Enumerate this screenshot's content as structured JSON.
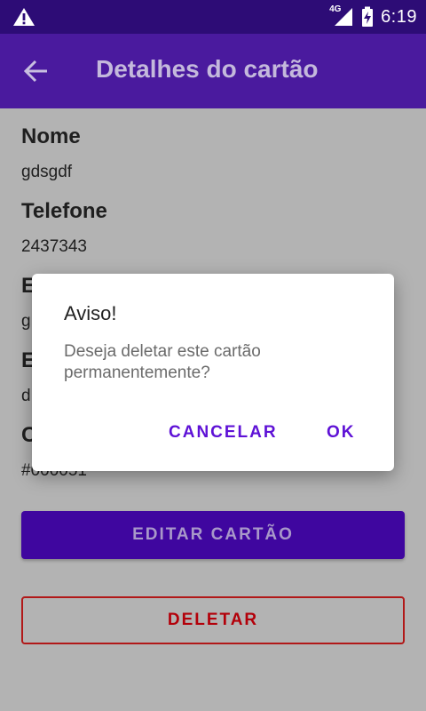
{
  "statusbar": {
    "network": "4G",
    "time": "6:19",
    "icons": [
      "warning-icon",
      "signal-icon",
      "battery-charging-icon"
    ]
  },
  "appbar": {
    "title": "Detalhes do cartão",
    "back_icon": "arrow-back-icon"
  },
  "details": [
    {
      "label": "Nome",
      "value": "gdsgdf"
    },
    {
      "label": "Telefone",
      "value": "2437343"
    },
    {
      "label": "E",
      "value": "g"
    },
    {
      "label": "E",
      "value": "d"
    },
    {
      "label": "C",
      "value": "#000051"
    }
  ],
  "actions": {
    "edit_label": "EDITAR CARTÃO",
    "delete_label": "DELETAR"
  },
  "dialog": {
    "title": "Aviso!",
    "message": "Deseja deletar este cartão permanentemente?",
    "cancel_label": "CANCELAR",
    "ok_label": "OK"
  },
  "colors": {
    "statusbar": "#2d0c76",
    "appbar": "#4a1a9e",
    "primary_button": "#3f069f",
    "danger": "#b3000a",
    "dialog_accent": "#5e11d6",
    "scrim_background": "#b3b3b3"
  }
}
